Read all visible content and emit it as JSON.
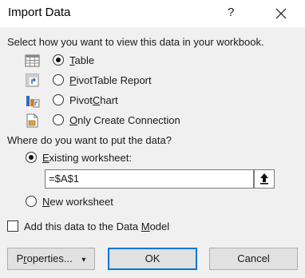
{
  "dialog": {
    "title": "Import Data",
    "help": "?",
    "close_icon": "close-icon"
  },
  "view_prompt": "Select how you want to view this data in your workbook.",
  "view_options": [
    {
      "pre": "",
      "key": "T",
      "post": "able",
      "selected": true,
      "icon": "table-icon"
    },
    {
      "pre": "",
      "key": "P",
      "post": "ivotTable Report",
      "selected": false,
      "icon": "pivottable-icon"
    },
    {
      "pre": "Pivot",
      "key": "C",
      "post": "hart",
      "selected": false,
      "icon": "pivotchart-icon"
    },
    {
      "pre": "",
      "key": "O",
      "post": "nly Create Connection",
      "selected": false,
      "icon": "connection-icon"
    }
  ],
  "put_prompt": "Where do you want to put the data?",
  "existing": {
    "pre": "",
    "key": "E",
    "post": "xisting worksheet:",
    "selected": true
  },
  "cell_ref": "=$A$1",
  "new_ws": {
    "pre": "",
    "key": "N",
    "post": "ew worksheet",
    "selected": false
  },
  "data_model": {
    "pre": "Add this data to the Data ",
    "key": "M",
    "post": "odel",
    "checked": false
  },
  "buttons": {
    "properties": {
      "pre": "P",
      "key": "r",
      "post": "operties...",
      "arrow": "▾"
    },
    "ok": "OK",
    "cancel": "Cancel"
  },
  "colors": {
    "focus": "#0078d7",
    "background": "#f0f0f0"
  }
}
